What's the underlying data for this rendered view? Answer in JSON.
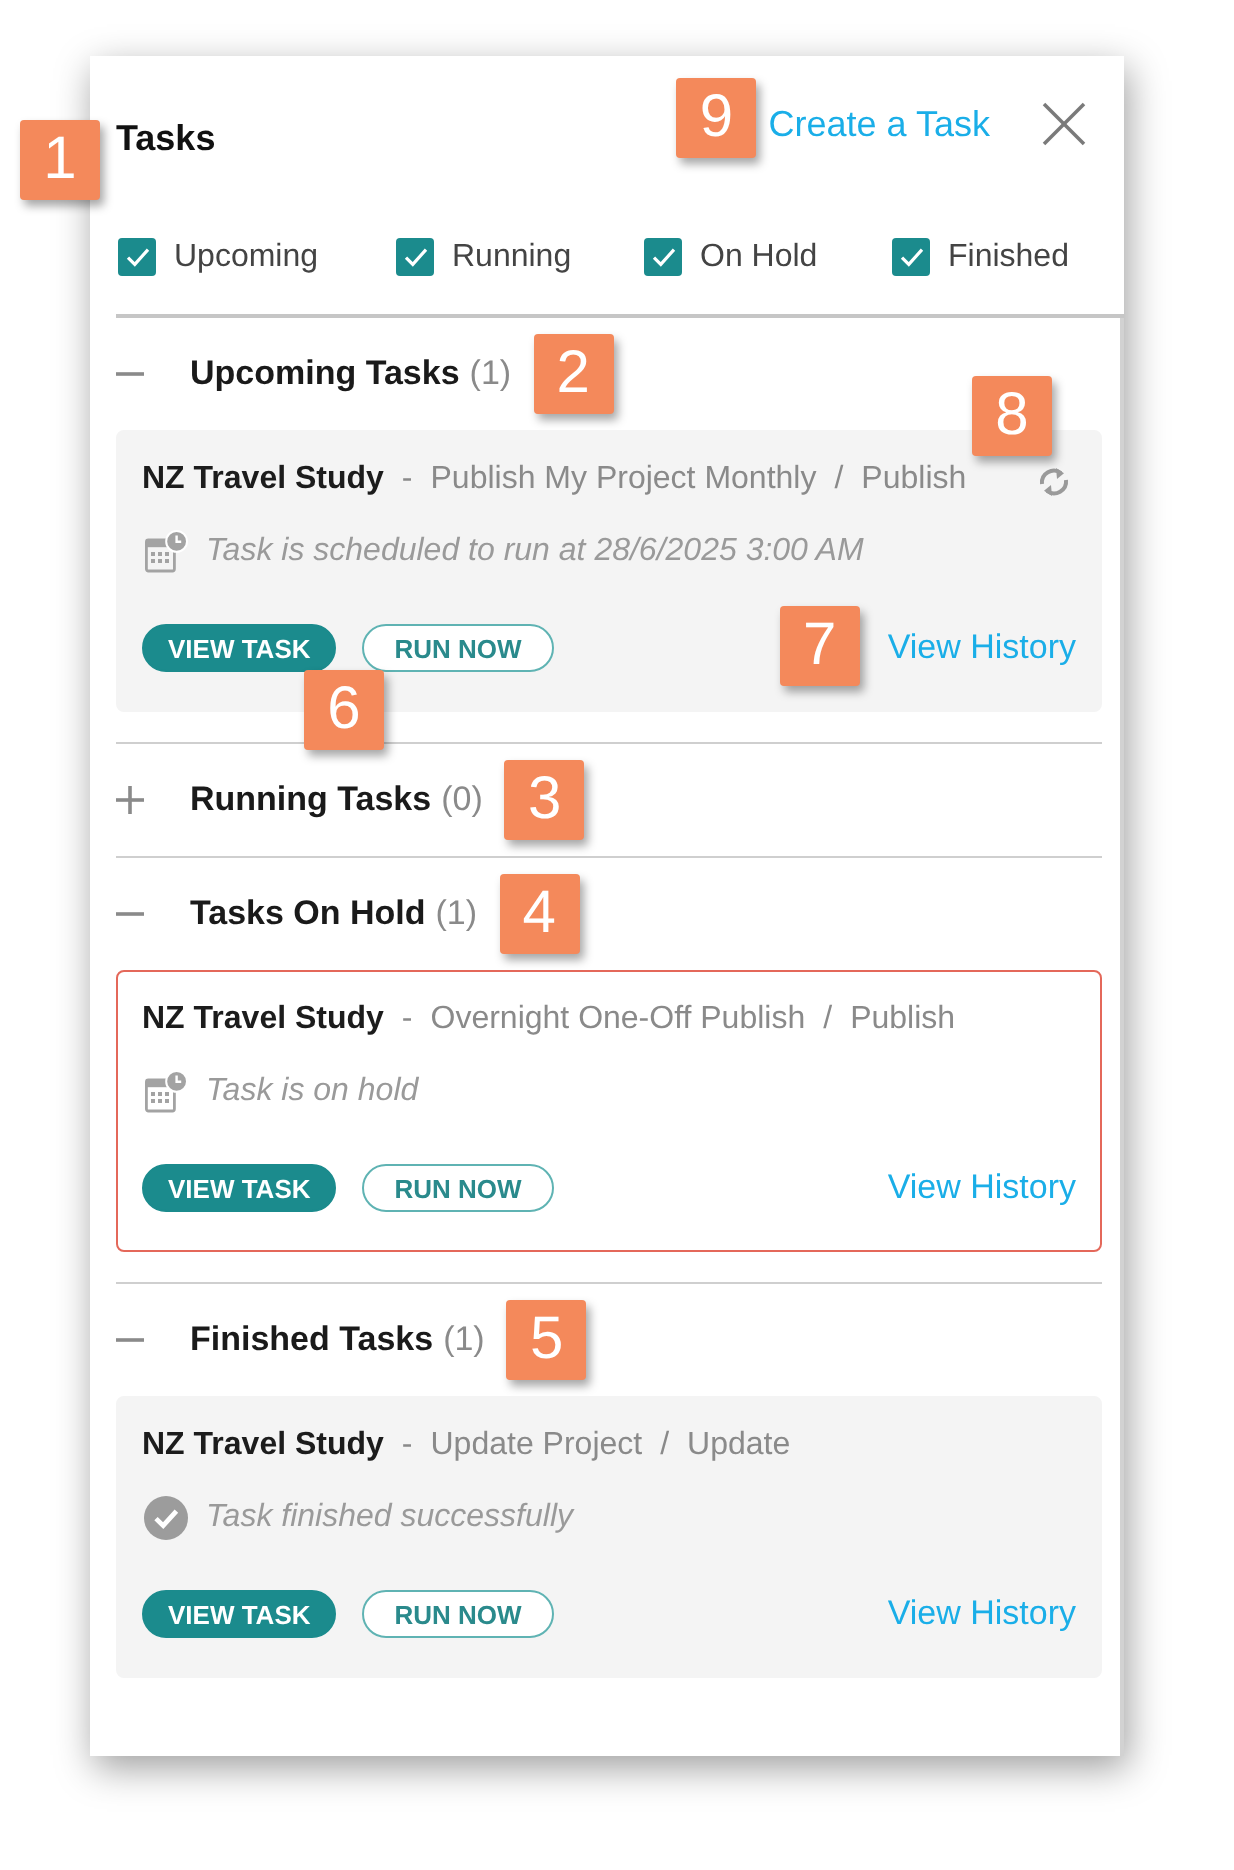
{
  "panel": {
    "title": "Tasks",
    "title_callout": "1",
    "create_link": "Create a Task",
    "create_callout": "9"
  },
  "filters": [
    {
      "label": "Upcoming",
      "checked": true
    },
    {
      "label": "Running",
      "checked": true
    },
    {
      "label": "On Hold",
      "checked": true
    },
    {
      "label": "Finished",
      "checked": true
    }
  ],
  "sections": [
    {
      "title": "Upcoming Tasks",
      "count": "(1)",
      "expanded": true,
      "callout": "2",
      "tasks": [
        {
          "project": "NZ Travel Study",
          "dash": "-",
          "name": "Publish My Project Monthly",
          "slash": "/",
          "action": "Publish",
          "recurring": true,
          "recurring_callout": "8",
          "flagged": false,
          "kind": "scheduled",
          "status": "Task is scheduled to run at 28/6/2025 3:00 AM",
          "buttons": [
            {
              "label": "VIEW TASK",
              "kind": "filled",
              "callout": "6"
            },
            {
              "label": "RUN NOW",
              "kind": "outline"
            }
          ],
          "history_link": "View History",
          "history_callout": "7"
        }
      ]
    },
    {
      "title": "Running Tasks",
      "count": "(0)",
      "expanded": false,
      "callout": "3"
    },
    {
      "title": "Tasks On Hold",
      "count": "(1)",
      "expanded": true,
      "callout": "4",
      "tasks": [
        {
          "project": "NZ Travel Study",
          "dash": "-",
          "name": "Overnight One-Off Publish",
          "slash": "/",
          "action": "Publish",
          "recurring": false,
          "flagged": true,
          "kind": "on_hold",
          "status": "Task is on hold",
          "buttons": [
            {
              "label": "VIEW TASK",
              "kind": "filled"
            },
            {
              "label": "RUN NOW",
              "kind": "outline"
            }
          ],
          "history_link": "View History"
        }
      ]
    },
    {
      "title": "Finished Tasks",
      "count": "(1)",
      "expanded": true,
      "callout": "5",
      "tasks": [
        {
          "project": "NZ Travel Study",
          "dash": "-",
          "name": "Update Project",
          "slash": "/",
          "action": "Update",
          "recurring": false,
          "flagged": false,
          "kind": "finished",
          "status": "Task finished successfully",
          "buttons": [
            {
              "label": "VIEW TASK",
              "kind": "filled"
            },
            {
              "label": "RUN NOW",
              "kind": "outline"
            }
          ],
          "history_link": "View History"
        }
      ]
    }
  ]
}
